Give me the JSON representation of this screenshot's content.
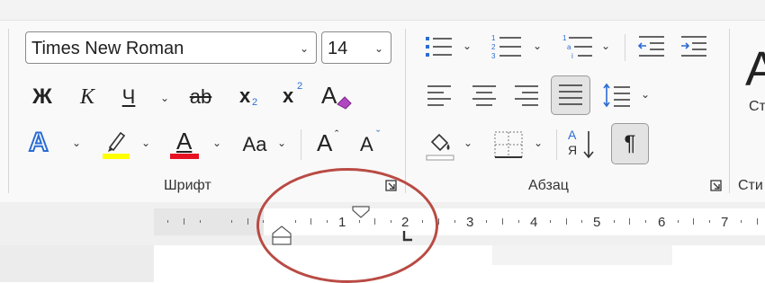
{
  "font": {
    "name": "Times New Roman",
    "size": "14",
    "bold": "Ж",
    "italic": "К",
    "underline": "Ч",
    "strikethrough": "ab",
    "subscript": "x",
    "subscript_mark": "2",
    "superscript": "x",
    "superscript_mark": "2",
    "text_effects": "A",
    "font_color": "A",
    "change_case": "Aa",
    "grow_font": "A",
    "shrink_font": "A",
    "group_label": "Шрифт"
  },
  "paragraph": {
    "show_marks": "¶",
    "sort_top": "А",
    "sort_bottom": "Я",
    "group_label": "Абзац"
  },
  "styles": {
    "preview": "А",
    "label_partial": "Ст",
    "group_label": "Сти"
  },
  "ruler": {
    "numbers": [
      "1",
      "2",
      "3",
      "4",
      "5",
      "6",
      "7"
    ]
  },
  "colors": {
    "highlight": "#ffff00",
    "font_color": "#e81123",
    "text_effects_blue": "#2b6cd4",
    "annotation": "#b94b44"
  }
}
